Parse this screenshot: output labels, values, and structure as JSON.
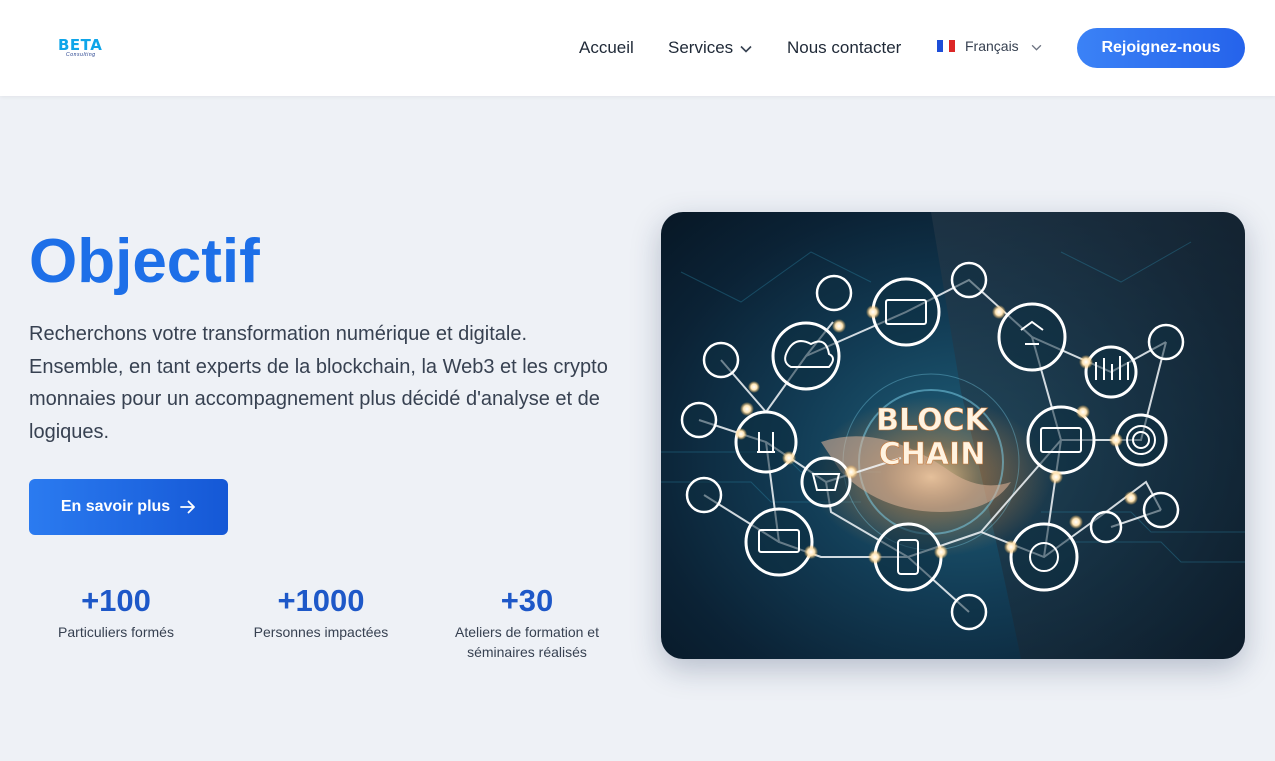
{
  "header": {
    "logo": {
      "text": "BETA",
      "sub": "Consulting"
    },
    "nav": {
      "home": "Accueil",
      "services": "Services",
      "contact": "Nous contacter"
    },
    "language": {
      "label": "Français",
      "flag_colors": [
        "#1d4ed8",
        "#ffffff",
        "#dc2626"
      ]
    },
    "join_button": "Rejoignez-nous"
  },
  "hero": {
    "title": "Objectif",
    "description": "Recherchons votre transformation numérique et digitale. Ensemble, en tant experts de la blockchain, la Web3 et les crypto monnaies pour un accompagnement plus décidé d'analyse et de logiques.",
    "cta_label": "En savoir plus"
  },
  "stats": [
    {
      "value": "+100",
      "label": "Particuliers formés"
    },
    {
      "value": "+1000",
      "label": "Personnes impactées"
    },
    {
      "value": "+30",
      "label": "Ateliers de formation et séminaires réalisés"
    }
  ],
  "image": {
    "line1": "BLOCK",
    "line2": "CHAIN"
  },
  "colors": {
    "accent": "#1d6fe8",
    "button": "#2563eb",
    "background": "#eef1f6"
  }
}
